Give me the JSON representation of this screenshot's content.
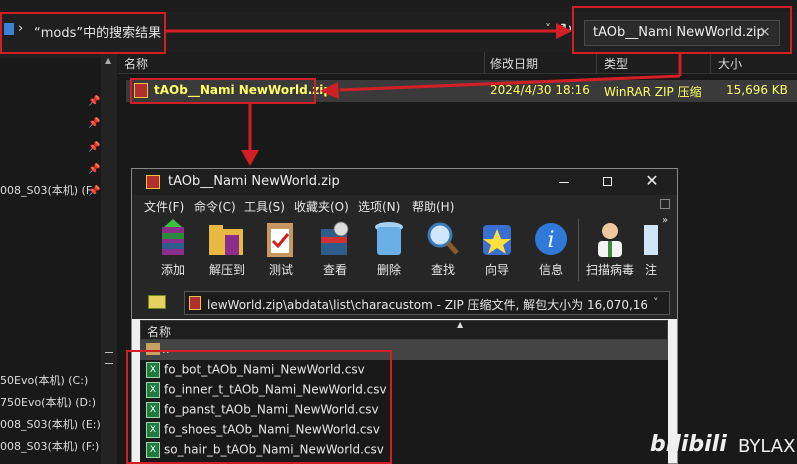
{
  "explorer": {
    "breadcrumb": "“mods”中的搜索结果",
    "search_value": "tAOb__Nami NewWorld.zip",
    "columns": [
      "名称",
      "修改日期",
      "类型",
      "大小"
    ],
    "file": {
      "name": "tAOb__Nami NewWorld.zip",
      "modified": "2024/4/30 18:16",
      "type": "WinRAR ZIP 压缩",
      "size": "15,696 KB"
    },
    "quick_access_label": "008_S03(本机) (F",
    "drives": [
      "50Evo(本机) (C:)",
      "750Evo(本机) (D:)",
      "008_S03(本机) (E:)",
      "008_S03(本机) (F:)"
    ]
  },
  "winrar": {
    "title": "tAOb__Nami NewWorld.zip",
    "menu": [
      "文件(F)",
      "命令(C)",
      "工具(S)",
      "收藏夹(O)",
      "选项(N)",
      "帮助(H)"
    ],
    "tools": [
      "添加",
      "解压到",
      "测试",
      "查看",
      "删除",
      "查找",
      "向导",
      "信息",
      "扫描病毒",
      "注"
    ],
    "path": "lewWorld.zip\\abdata\\list\\characustom - ZIP 压缩文件, 解包大小为 16,070,160 字节",
    "column_name": "名称",
    "parent_row": "..",
    "files": [
      "fo_bot_tAOb_Nami_NewWorld.csv",
      "fo_inner_t_tAOb_Nami_NewWorld.csv",
      "fo_panst_tAOb_Nami_NewWorld.csv",
      "fo_shoes_tAOb_Nami_NewWorld.csv",
      "so_hair_b_tAOb_Nami_NewWorld.csv"
    ]
  },
  "watermark": "BYLAX",
  "colors": {
    "annotation": "#d21f26",
    "highlight": "#ffff00",
    "selection": "#3a3a3a"
  }
}
